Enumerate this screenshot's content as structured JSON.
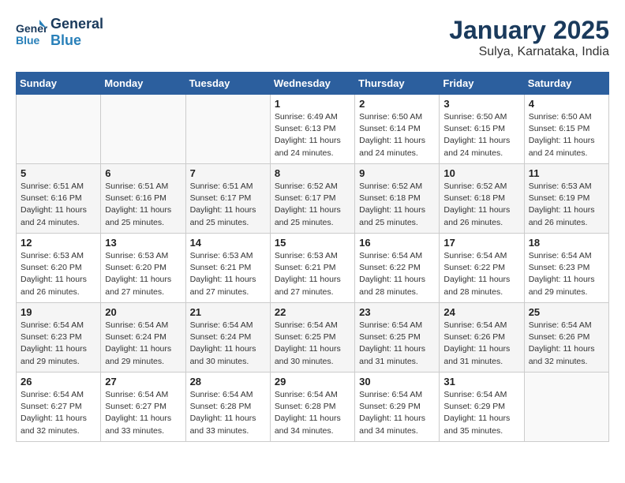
{
  "logo": {
    "line1": "General",
    "line2": "Blue"
  },
  "title": "January 2025",
  "subtitle": "Sulya, Karnataka, India",
  "weekdays": [
    "Sunday",
    "Monday",
    "Tuesday",
    "Wednesday",
    "Thursday",
    "Friday",
    "Saturday"
  ],
  "weeks": [
    [
      {
        "day": "",
        "info": ""
      },
      {
        "day": "",
        "info": ""
      },
      {
        "day": "",
        "info": ""
      },
      {
        "day": "1",
        "info": "Sunrise: 6:49 AM\nSunset: 6:13 PM\nDaylight: 11 hours\nand 24 minutes."
      },
      {
        "day": "2",
        "info": "Sunrise: 6:50 AM\nSunset: 6:14 PM\nDaylight: 11 hours\nand 24 minutes."
      },
      {
        "day": "3",
        "info": "Sunrise: 6:50 AM\nSunset: 6:15 PM\nDaylight: 11 hours\nand 24 minutes."
      },
      {
        "day": "4",
        "info": "Sunrise: 6:50 AM\nSunset: 6:15 PM\nDaylight: 11 hours\nand 24 minutes."
      }
    ],
    [
      {
        "day": "5",
        "info": "Sunrise: 6:51 AM\nSunset: 6:16 PM\nDaylight: 11 hours\nand 24 minutes."
      },
      {
        "day": "6",
        "info": "Sunrise: 6:51 AM\nSunset: 6:16 PM\nDaylight: 11 hours\nand 25 minutes."
      },
      {
        "day": "7",
        "info": "Sunrise: 6:51 AM\nSunset: 6:17 PM\nDaylight: 11 hours\nand 25 minutes."
      },
      {
        "day": "8",
        "info": "Sunrise: 6:52 AM\nSunset: 6:17 PM\nDaylight: 11 hours\nand 25 minutes."
      },
      {
        "day": "9",
        "info": "Sunrise: 6:52 AM\nSunset: 6:18 PM\nDaylight: 11 hours\nand 25 minutes."
      },
      {
        "day": "10",
        "info": "Sunrise: 6:52 AM\nSunset: 6:18 PM\nDaylight: 11 hours\nand 26 minutes."
      },
      {
        "day": "11",
        "info": "Sunrise: 6:53 AM\nSunset: 6:19 PM\nDaylight: 11 hours\nand 26 minutes."
      }
    ],
    [
      {
        "day": "12",
        "info": "Sunrise: 6:53 AM\nSunset: 6:20 PM\nDaylight: 11 hours\nand 26 minutes."
      },
      {
        "day": "13",
        "info": "Sunrise: 6:53 AM\nSunset: 6:20 PM\nDaylight: 11 hours\nand 27 minutes."
      },
      {
        "day": "14",
        "info": "Sunrise: 6:53 AM\nSunset: 6:21 PM\nDaylight: 11 hours\nand 27 minutes."
      },
      {
        "day": "15",
        "info": "Sunrise: 6:53 AM\nSunset: 6:21 PM\nDaylight: 11 hours\nand 27 minutes."
      },
      {
        "day": "16",
        "info": "Sunrise: 6:54 AM\nSunset: 6:22 PM\nDaylight: 11 hours\nand 28 minutes."
      },
      {
        "day": "17",
        "info": "Sunrise: 6:54 AM\nSunset: 6:22 PM\nDaylight: 11 hours\nand 28 minutes."
      },
      {
        "day": "18",
        "info": "Sunrise: 6:54 AM\nSunset: 6:23 PM\nDaylight: 11 hours\nand 29 minutes."
      }
    ],
    [
      {
        "day": "19",
        "info": "Sunrise: 6:54 AM\nSunset: 6:23 PM\nDaylight: 11 hours\nand 29 minutes."
      },
      {
        "day": "20",
        "info": "Sunrise: 6:54 AM\nSunset: 6:24 PM\nDaylight: 11 hours\nand 29 minutes."
      },
      {
        "day": "21",
        "info": "Sunrise: 6:54 AM\nSunset: 6:24 PM\nDaylight: 11 hours\nand 30 minutes."
      },
      {
        "day": "22",
        "info": "Sunrise: 6:54 AM\nSunset: 6:25 PM\nDaylight: 11 hours\nand 30 minutes."
      },
      {
        "day": "23",
        "info": "Sunrise: 6:54 AM\nSunset: 6:25 PM\nDaylight: 11 hours\nand 31 minutes."
      },
      {
        "day": "24",
        "info": "Sunrise: 6:54 AM\nSunset: 6:26 PM\nDaylight: 11 hours\nand 31 minutes."
      },
      {
        "day": "25",
        "info": "Sunrise: 6:54 AM\nSunset: 6:26 PM\nDaylight: 11 hours\nand 32 minutes."
      }
    ],
    [
      {
        "day": "26",
        "info": "Sunrise: 6:54 AM\nSunset: 6:27 PM\nDaylight: 11 hours\nand 32 minutes."
      },
      {
        "day": "27",
        "info": "Sunrise: 6:54 AM\nSunset: 6:27 PM\nDaylight: 11 hours\nand 33 minutes."
      },
      {
        "day": "28",
        "info": "Sunrise: 6:54 AM\nSunset: 6:28 PM\nDaylight: 11 hours\nand 33 minutes."
      },
      {
        "day": "29",
        "info": "Sunrise: 6:54 AM\nSunset: 6:28 PM\nDaylight: 11 hours\nand 34 minutes."
      },
      {
        "day": "30",
        "info": "Sunrise: 6:54 AM\nSunset: 6:29 PM\nDaylight: 11 hours\nand 34 minutes."
      },
      {
        "day": "31",
        "info": "Sunrise: 6:54 AM\nSunset: 6:29 PM\nDaylight: 11 hours\nand 35 minutes."
      },
      {
        "day": "",
        "info": ""
      }
    ]
  ]
}
